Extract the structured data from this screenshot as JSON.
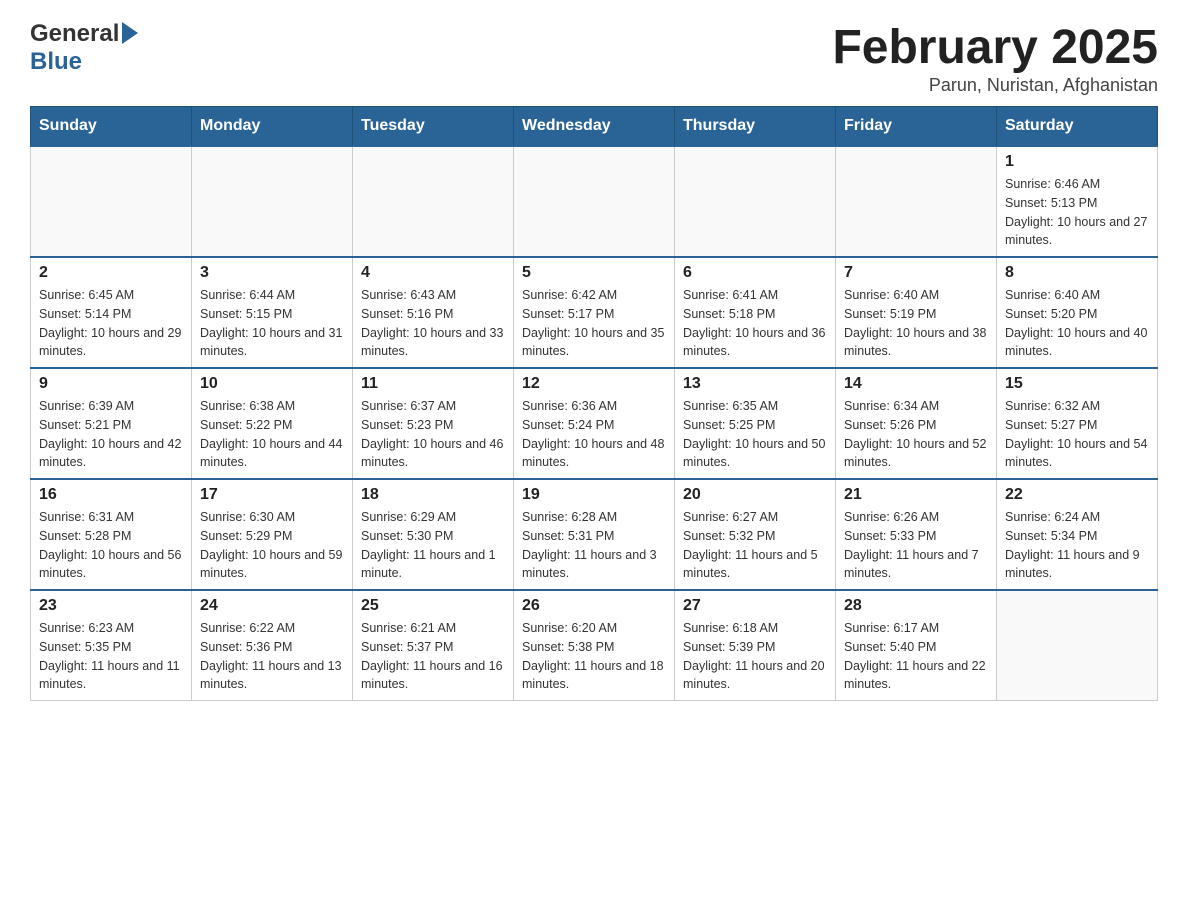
{
  "header": {
    "logo_general": "General",
    "logo_blue": "Blue",
    "month_title": "February 2025",
    "location": "Parun, Nuristan, Afghanistan"
  },
  "days_of_week": [
    "Sunday",
    "Monday",
    "Tuesday",
    "Wednesday",
    "Thursday",
    "Friday",
    "Saturday"
  ],
  "weeks": [
    [
      {
        "day": "",
        "info": ""
      },
      {
        "day": "",
        "info": ""
      },
      {
        "day": "",
        "info": ""
      },
      {
        "day": "",
        "info": ""
      },
      {
        "day": "",
        "info": ""
      },
      {
        "day": "",
        "info": ""
      },
      {
        "day": "1",
        "info": "Sunrise: 6:46 AM\nSunset: 5:13 PM\nDaylight: 10 hours and 27 minutes."
      }
    ],
    [
      {
        "day": "2",
        "info": "Sunrise: 6:45 AM\nSunset: 5:14 PM\nDaylight: 10 hours and 29 minutes."
      },
      {
        "day": "3",
        "info": "Sunrise: 6:44 AM\nSunset: 5:15 PM\nDaylight: 10 hours and 31 minutes."
      },
      {
        "day": "4",
        "info": "Sunrise: 6:43 AM\nSunset: 5:16 PM\nDaylight: 10 hours and 33 minutes."
      },
      {
        "day": "5",
        "info": "Sunrise: 6:42 AM\nSunset: 5:17 PM\nDaylight: 10 hours and 35 minutes."
      },
      {
        "day": "6",
        "info": "Sunrise: 6:41 AM\nSunset: 5:18 PM\nDaylight: 10 hours and 36 minutes."
      },
      {
        "day": "7",
        "info": "Sunrise: 6:40 AM\nSunset: 5:19 PM\nDaylight: 10 hours and 38 minutes."
      },
      {
        "day": "8",
        "info": "Sunrise: 6:40 AM\nSunset: 5:20 PM\nDaylight: 10 hours and 40 minutes."
      }
    ],
    [
      {
        "day": "9",
        "info": "Sunrise: 6:39 AM\nSunset: 5:21 PM\nDaylight: 10 hours and 42 minutes."
      },
      {
        "day": "10",
        "info": "Sunrise: 6:38 AM\nSunset: 5:22 PM\nDaylight: 10 hours and 44 minutes."
      },
      {
        "day": "11",
        "info": "Sunrise: 6:37 AM\nSunset: 5:23 PM\nDaylight: 10 hours and 46 minutes."
      },
      {
        "day": "12",
        "info": "Sunrise: 6:36 AM\nSunset: 5:24 PM\nDaylight: 10 hours and 48 minutes."
      },
      {
        "day": "13",
        "info": "Sunrise: 6:35 AM\nSunset: 5:25 PM\nDaylight: 10 hours and 50 minutes."
      },
      {
        "day": "14",
        "info": "Sunrise: 6:34 AM\nSunset: 5:26 PM\nDaylight: 10 hours and 52 minutes."
      },
      {
        "day": "15",
        "info": "Sunrise: 6:32 AM\nSunset: 5:27 PM\nDaylight: 10 hours and 54 minutes."
      }
    ],
    [
      {
        "day": "16",
        "info": "Sunrise: 6:31 AM\nSunset: 5:28 PM\nDaylight: 10 hours and 56 minutes."
      },
      {
        "day": "17",
        "info": "Sunrise: 6:30 AM\nSunset: 5:29 PM\nDaylight: 10 hours and 59 minutes."
      },
      {
        "day": "18",
        "info": "Sunrise: 6:29 AM\nSunset: 5:30 PM\nDaylight: 11 hours and 1 minute."
      },
      {
        "day": "19",
        "info": "Sunrise: 6:28 AM\nSunset: 5:31 PM\nDaylight: 11 hours and 3 minutes."
      },
      {
        "day": "20",
        "info": "Sunrise: 6:27 AM\nSunset: 5:32 PM\nDaylight: 11 hours and 5 minutes."
      },
      {
        "day": "21",
        "info": "Sunrise: 6:26 AM\nSunset: 5:33 PM\nDaylight: 11 hours and 7 minutes."
      },
      {
        "day": "22",
        "info": "Sunrise: 6:24 AM\nSunset: 5:34 PM\nDaylight: 11 hours and 9 minutes."
      }
    ],
    [
      {
        "day": "23",
        "info": "Sunrise: 6:23 AM\nSunset: 5:35 PM\nDaylight: 11 hours and 11 minutes."
      },
      {
        "day": "24",
        "info": "Sunrise: 6:22 AM\nSunset: 5:36 PM\nDaylight: 11 hours and 13 minutes."
      },
      {
        "day": "25",
        "info": "Sunrise: 6:21 AM\nSunset: 5:37 PM\nDaylight: 11 hours and 16 minutes."
      },
      {
        "day": "26",
        "info": "Sunrise: 6:20 AM\nSunset: 5:38 PM\nDaylight: 11 hours and 18 minutes."
      },
      {
        "day": "27",
        "info": "Sunrise: 6:18 AM\nSunset: 5:39 PM\nDaylight: 11 hours and 20 minutes."
      },
      {
        "day": "28",
        "info": "Sunrise: 6:17 AM\nSunset: 5:40 PM\nDaylight: 11 hours and 22 minutes."
      },
      {
        "day": "",
        "info": ""
      }
    ]
  ]
}
